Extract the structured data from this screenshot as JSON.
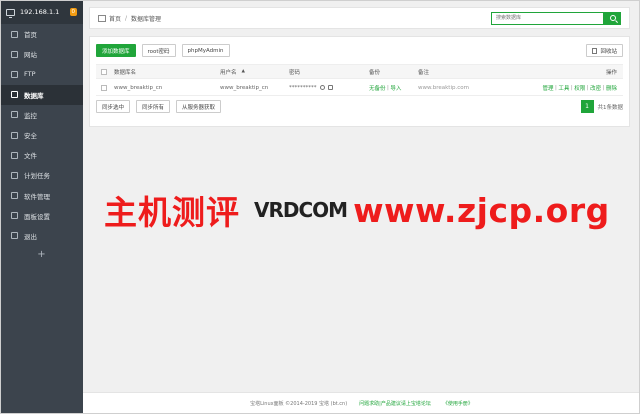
{
  "sidebar": {
    "server_ip": "192.168.1.1",
    "badge": "0",
    "items": [
      {
        "label": "首页",
        "icon": "home-icon",
        "active": false
      },
      {
        "label": "网站",
        "icon": "globe-icon",
        "active": false
      },
      {
        "label": "FTP",
        "icon": "ftp-icon",
        "active": false
      },
      {
        "label": "数据库",
        "icon": "database-icon",
        "active": true
      },
      {
        "label": "监控",
        "icon": "monitor-icon",
        "active": false
      },
      {
        "label": "安全",
        "icon": "shield-icon",
        "active": false
      },
      {
        "label": "文件",
        "icon": "folder-icon",
        "active": false
      },
      {
        "label": "计划任务",
        "icon": "calendar-icon",
        "active": false
      },
      {
        "label": "软件管理",
        "icon": "apps-icon",
        "active": false
      },
      {
        "label": "面板设置",
        "icon": "gear-icon",
        "active": false
      },
      {
        "label": "退出",
        "icon": "logout-icon",
        "active": false
      }
    ],
    "add_label": "+"
  },
  "header": {
    "home_label": "首页",
    "separator": "/",
    "current": "数据库管理",
    "search_placeholder": "搜索数据库"
  },
  "toolbar": {
    "add_db": "添加数据库",
    "root_password": "root密码",
    "phpmyadmin": "phpMyAdmin",
    "recycle_bin": "回收站"
  },
  "table": {
    "columns": {
      "name": "数据库名",
      "user": "用户名",
      "sort_arrow": "▲",
      "password": "密码",
      "backup": "备份",
      "note": "备注",
      "actions": "操作"
    },
    "rows": [
      {
        "name": "www_breaktip_cn",
        "user": "www_breaktip_cn",
        "password": "**********",
        "backup_none": "无备份",
        "backup_sep": "|",
        "backup_import": "导入",
        "note": "www.breaktip.com",
        "actions": [
          "管理",
          "工具",
          "权限",
          "改密",
          "删除"
        ]
      }
    ]
  },
  "bottom": {
    "sync_selected": "同步选中",
    "sync_all": "同步所有",
    "fetch_from_server": "从服务器获取",
    "page": "1",
    "total": "共1条数据"
  },
  "watermark": {
    "cn_text": "主机测评",
    "logo_text": "VRDCOM",
    "url": "www.zjcp.org"
  },
  "footer": {
    "copyright": "宝塔Linux面板 ©2014-2019 宝塔 (bt.cn)",
    "forum": "问题求助|产品建议请上宝塔论坛",
    "manual": "《使用手册》"
  },
  "colors": {
    "accent": "#20a53a",
    "sidebar_bg": "#3c444d",
    "watermark_red": "#ee1c1c"
  }
}
